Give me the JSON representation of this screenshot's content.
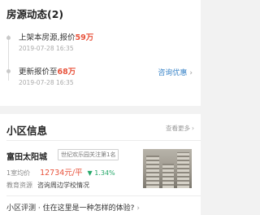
{
  "dynamics": {
    "title": "房源动态(2)",
    "events": [
      {
        "prefix": "上架本房源,报价",
        "highlight": "59万",
        "date": "2019-07-28 16:35"
      },
      {
        "prefix": "更新报价至",
        "highlight": "68万",
        "date": "2019-07-28 16:35"
      }
    ],
    "consult_link": "咨询优惠",
    "chevron": "›"
  },
  "community": {
    "title": "小区信息",
    "see_more": "查看更多",
    "chevron": "›",
    "name": "富田太阳城",
    "badge": "世纪欢乐园关注第1名",
    "transit_label": "1室均价",
    "price": "12734元/平",
    "change": "1.34%",
    "change_arrow": "▼",
    "edu_label": "教育资源",
    "edu_value": "咨询周边学校情况",
    "review": "小区评测 · 住在这里是一种怎样的体验?",
    "photo_icon": "building-photo"
  },
  "colors": {
    "accent_red": "#e8533c",
    "link_blue": "#3c86c9",
    "down_green": "#25a86a"
  }
}
